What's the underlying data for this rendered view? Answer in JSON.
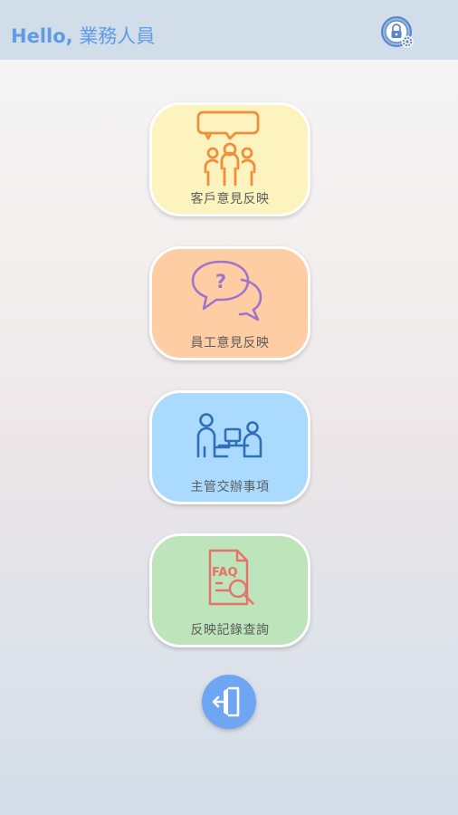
{
  "header": {
    "greeting_prefix": "Hello,",
    "user_name": "業務人員",
    "settings_icon": "lock-gear-icon"
  },
  "menu": {
    "items": [
      {
        "label": "客戶意見反映",
        "icon": "customers-chat-icon",
        "color": "#fdf3bf"
      },
      {
        "label": "員工意見反映",
        "icon": "question-chat-bubbles-icon",
        "color": "#ffcda4"
      },
      {
        "label": "主管交辦事項",
        "icon": "meeting-desk-icon",
        "color": "#aadbff"
      },
      {
        "label": "反映記錄查詢",
        "icon": "faq-search-icon",
        "color": "#bde4ba"
      }
    ]
  },
  "logout": {
    "icon": "logout-door-icon",
    "color": "#6ea6f3"
  },
  "colors": {
    "accent": "#5f9be6",
    "header_bg": "#d1dde9"
  }
}
